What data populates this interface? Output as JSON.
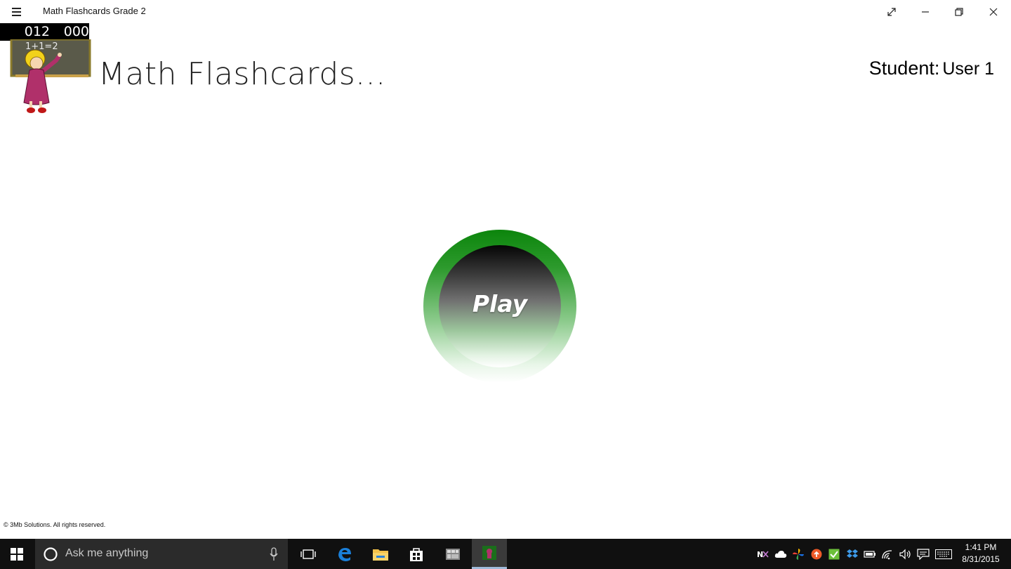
{
  "window": {
    "title": "Math Flashcards Grade 2"
  },
  "scores": {
    "left": "012",
    "right": "000"
  },
  "main": {
    "heading": "Math Flashcards...",
    "student_label": "Student:",
    "student_name": "User 1",
    "play_label": "Play",
    "chalkboard_text": "1+1=2"
  },
  "footer": {
    "copyright": "© 3Mb Solutions. All rights reserved."
  },
  "taskbar": {
    "search_placeholder": "Ask me anything",
    "time": "1:41 PM",
    "date": "8/31/2015",
    "pinned_apps": [
      "task-view",
      "edge",
      "file-explorer",
      "store",
      "app",
      "math-flashcards"
    ],
    "tray_icons": [
      "onenote",
      "onedrive",
      "photos",
      "upload",
      "checklist",
      "dropbox",
      "battery",
      "wifi",
      "volume",
      "action-center",
      "keyboard"
    ]
  },
  "colors": {
    "play_ring": "#0c850c",
    "taskbar": "#101010",
    "score_box": "#000000"
  }
}
